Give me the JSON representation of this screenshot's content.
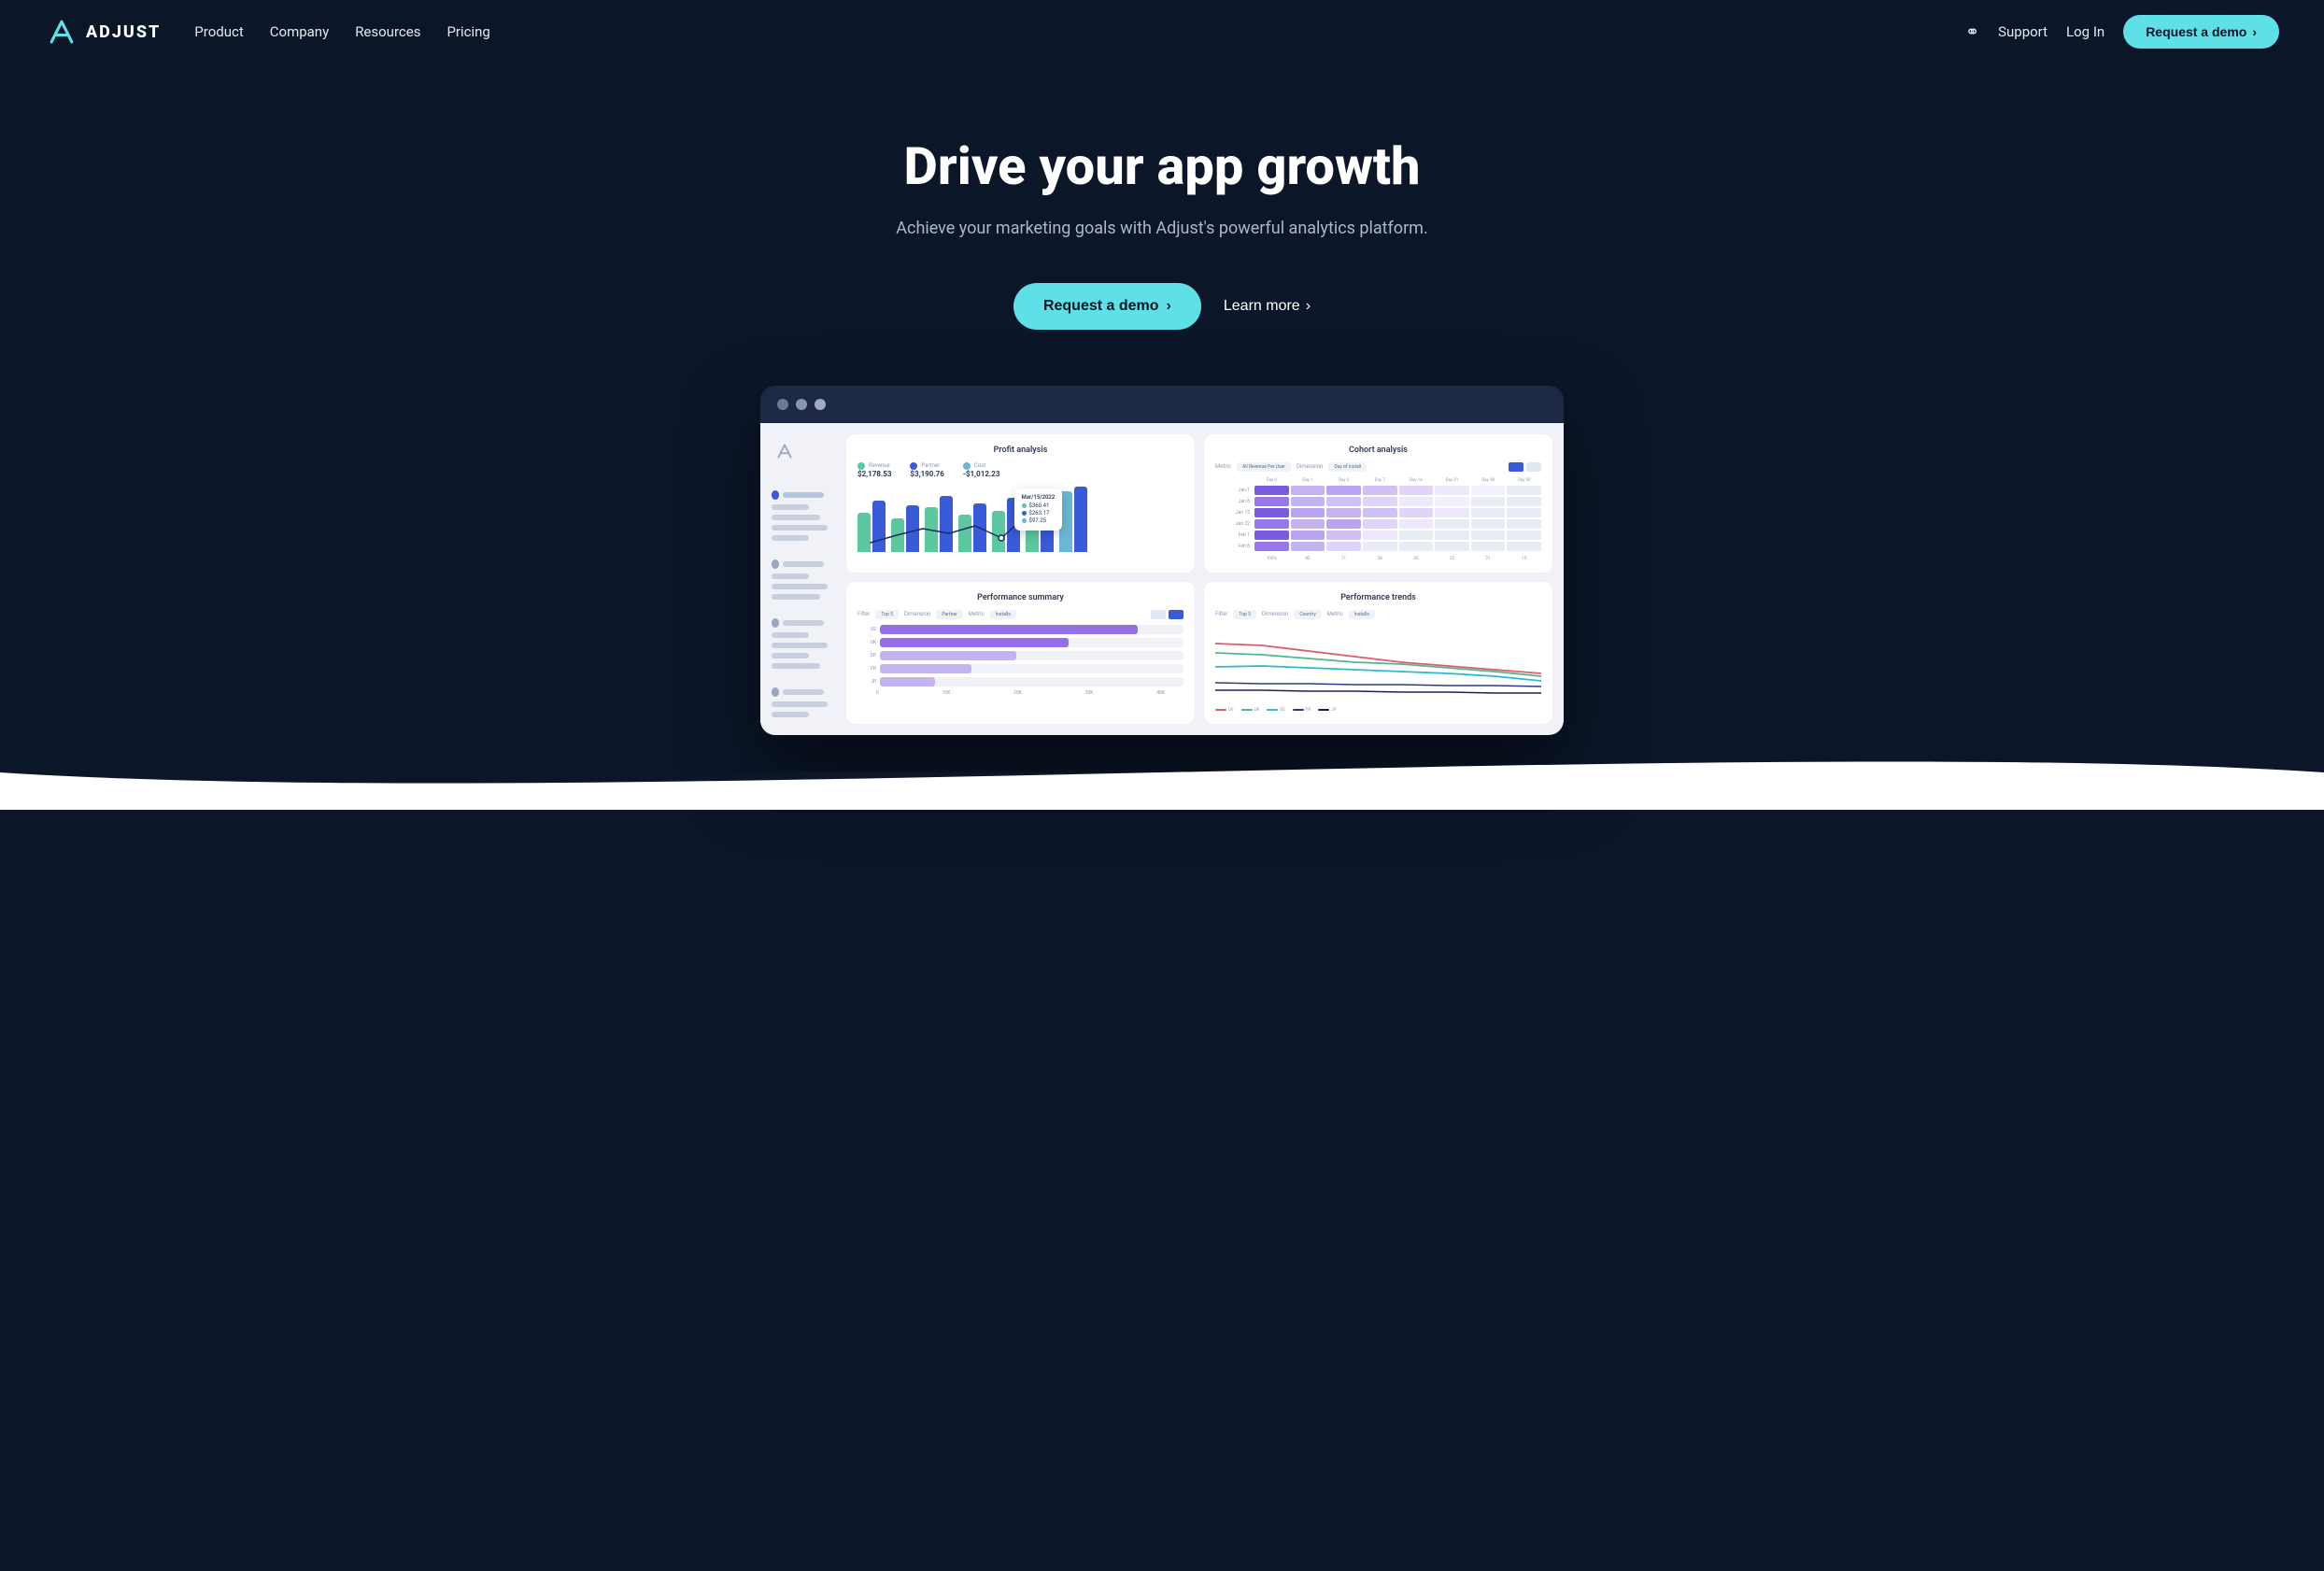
{
  "nav": {
    "logo_text": "ADJUST",
    "links": [
      {
        "label": "Product",
        "id": "product"
      },
      {
        "label": "Company",
        "id": "company"
      },
      {
        "label": "Resources",
        "id": "resources"
      },
      {
        "label": "Pricing",
        "id": "pricing"
      }
    ],
    "support_label": "Support",
    "login_label": "Log In",
    "demo_label": "Request a demo",
    "demo_arrow": "›"
  },
  "hero": {
    "title": "Drive your app growth",
    "subtitle": "Achieve your marketing goals with Adjust's powerful analytics platform.",
    "demo_button": "Request a demo",
    "demo_arrow": "›",
    "learn_more_button": "Learn more",
    "learn_more_arrow": "›"
  },
  "dashboard": {
    "window_dots": [
      "",
      "",
      ""
    ],
    "charts": {
      "profit": {
        "title": "Profit analysis",
        "stats": [
          {
            "color": "#5bc8a0",
            "label": "Revenue",
            "value": "$2,178.53"
          },
          {
            "color": "#3a5bd9",
            "label": "Partner",
            "value": "$3,190.76"
          },
          {
            "color": "#6ab8d4",
            "label": "Cost",
            "value": "-$1,012.23"
          }
        ],
        "tooltip": {
          "date": "Mar/15/2022",
          "rows": [
            {
              "color": "#5bc8a0",
              "value": "$360.41"
            },
            {
              "color": "#3a5bd9",
              "value": "$263.17"
            },
            {
              "color": "#6ab8d4",
              "value": "$97.25"
            }
          ]
        }
      },
      "cohort": {
        "title": "Cohort analysis",
        "filter1": "Metric",
        "filter1_val": "All Revenue Per User",
        "filter2": "Dimension",
        "filter2_val": "Day of install"
      },
      "performance_summary": {
        "title": "Performance summary",
        "filter_filter": "Top 5",
        "filter_dimension": "Partner",
        "filter_metric": "Installs"
      },
      "performance_trends": {
        "title": "Performance trends",
        "filter_filter": "Top 5",
        "filter_dimension": "Country",
        "filter_metric": "Installs"
      }
    }
  }
}
